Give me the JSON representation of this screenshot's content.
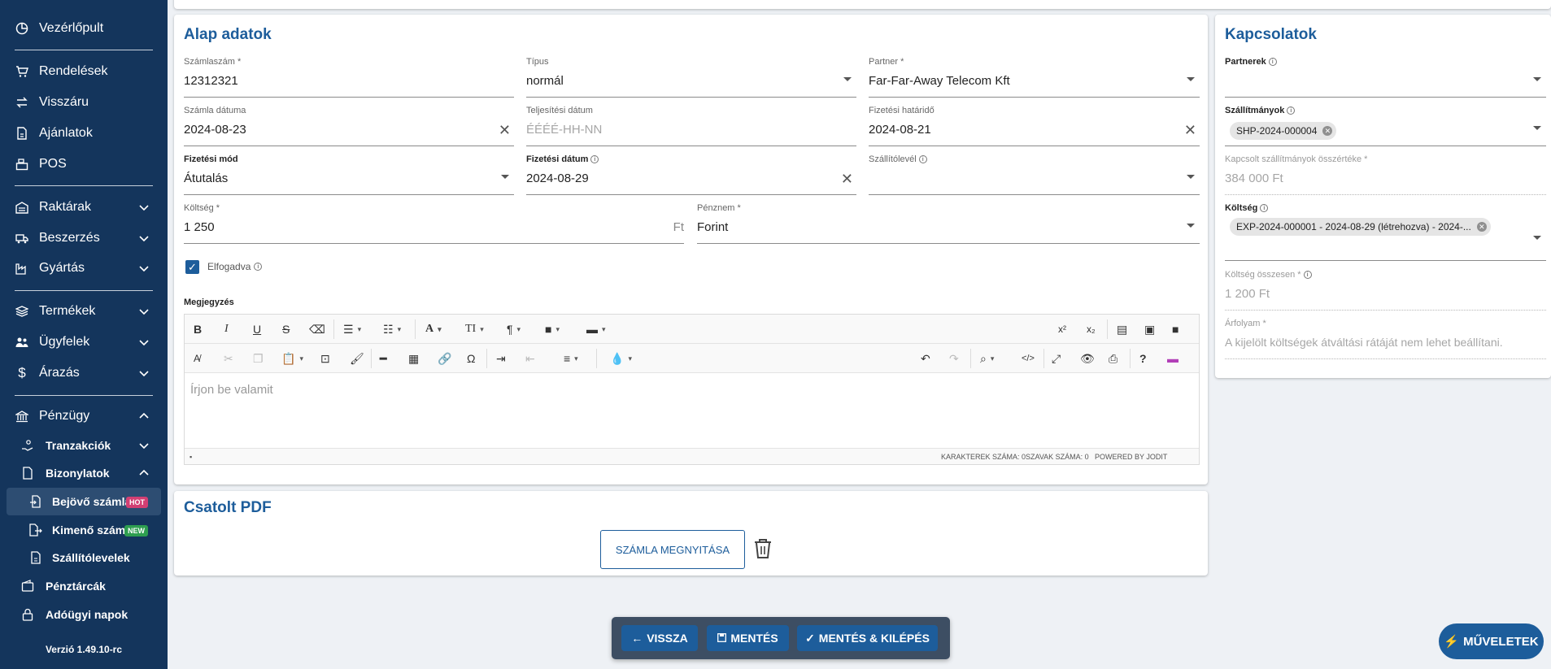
{
  "sidebar": {
    "dashboard": "Vezérlőpult",
    "orders": "Rendelések",
    "returns": "Visszáru",
    "quotes": "Ajánlatok",
    "pos": "POS",
    "warehouses": "Raktárak",
    "procurement": "Beszerzés",
    "production": "Gyártás",
    "products": "Termékek",
    "customers": "Ügyfelek",
    "pricing": "Árazás",
    "finance": "Pénzügy",
    "transactions": "Tranzakciók",
    "documents": "Bizonylatok",
    "incoming_invoices": "Bejövő számlák",
    "incoming_badge": "HOT",
    "outgoing_invoices": "Kimenő számlák",
    "outgoing_badge": "NEW",
    "delivery_notes": "Szállítólevelek",
    "wallets": "Pénztárcák",
    "tax_days": "Adóügyi napok",
    "version": "Verzió 1.49.10-rc"
  },
  "basic": {
    "title": "Alap adatok",
    "invoice_number_label": "Számlaszám *",
    "invoice_number": "12312321",
    "type_label": "Típus",
    "type": "normál",
    "partner_label": "Partner *",
    "partner": "Far-Far-Away Telecom Kft",
    "invoice_date_label": "Számla dátuma",
    "invoice_date": "2024-08-23",
    "fulfillment_label": "Teljesítési dátum",
    "fulfillment_placeholder": "ÉÉÉÉ-HH-NN",
    "due_label": "Fizetési határidő",
    "due": "2024-08-21",
    "payment_method_label": "Fizetési mód",
    "payment_method": "Átutalás",
    "payment_date_label": "Fizetési dátum",
    "payment_date": "2024-08-29",
    "delivery_note_label": "Szállítólevél",
    "cost_label": "Költség *",
    "cost": "1 250",
    "cost_suffix": "Ft",
    "currency_label": "Pénznem *",
    "currency": "Forint",
    "accepted_label": "Elfogadva",
    "note_label": "Megjegyzés",
    "editor_placeholder": "Írjon be valamit",
    "status_chars": "KARAKTEREK SZÁMA: 0",
    "status_words": "SZAVAK SZÁMA: 0",
    "status_powered": "POWERED BY JODIT"
  },
  "pdf": {
    "title": "Csatolt PDF",
    "open_button": "SZÁMLA MEGNYITÁSA"
  },
  "relations": {
    "title": "Kapcsolatok",
    "partners_label": "Partnerek",
    "shipments_label": "Szállítmányok",
    "shipment_chip": "SHP-2024-000004",
    "linked_total_label": "Kapcsolt szállítmányok összértéke *",
    "linked_total": "384 000 Ft",
    "cost_label": "Költség",
    "cost_chip": "EXP-2024-000001 - 2024-08-29 (létrehozva) - 2024-...",
    "cost_total_label": "Költség összesen *",
    "cost_total": "1 200 Ft",
    "rate_label": "Árfolyam *",
    "rate_text": "A kijelölt költségek átváltási rátáját nem lehet beállítani."
  },
  "actions": {
    "back": "VISSZA",
    "save": "MENTÉS",
    "save_exit": "MENTÉS & KILÉPÉS",
    "operations": "MŰVELETEK"
  },
  "colors": {
    "sidebar": "#14355c",
    "accent": "#1d5d9b",
    "hot": "#d23f73",
    "new": "#2e9e50"
  }
}
